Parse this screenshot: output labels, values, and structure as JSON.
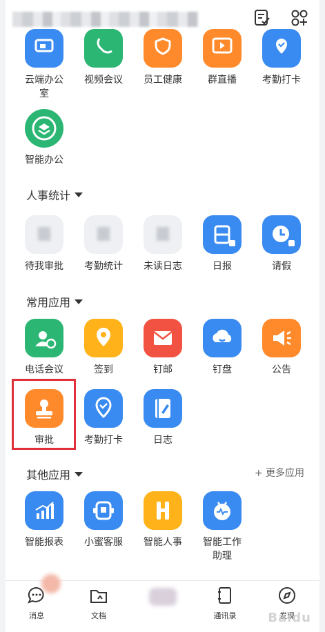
{
  "top_icons": [
    "todo-list-icon",
    "app-grid-icon"
  ],
  "row1": [
    {
      "label": "云端办公室",
      "icon": "cloud-office-icon",
      "color": "blue"
    },
    {
      "label": "视频会议",
      "icon": "video-call-icon",
      "color": "green"
    },
    {
      "label": "员工健康",
      "icon": "health-shield-icon",
      "color": "orange"
    },
    {
      "label": "群直播",
      "icon": "live-play-icon",
      "color": "orange"
    },
    {
      "label": "考勤打卡",
      "icon": "location-check-icon",
      "color": "blue"
    }
  ],
  "row2": [
    {
      "label": "智能办公",
      "icon": "layers-icon",
      "color": "green"
    }
  ],
  "hr_section": {
    "title": "人事统计",
    "items": [
      {
        "label": "待我审批",
        "icon": "blurred-icon"
      },
      {
        "label": "考勤统计",
        "icon": "blurred-icon"
      },
      {
        "label": "未读日志",
        "icon": "blurred-icon"
      },
      {
        "label": "日报",
        "icon": "daily-report-icon"
      },
      {
        "label": "请假",
        "icon": "clock-icon"
      }
    ]
  },
  "common_section": {
    "title": "常用应用",
    "items": [
      {
        "label": "电话会议",
        "icon": "phone-conference-icon",
        "color": "green"
      },
      {
        "label": "签到",
        "icon": "checkin-pin-icon",
        "color": "yellow"
      },
      {
        "label": "钉邮",
        "icon": "mail-icon",
        "color": "red"
      },
      {
        "label": "钉盘",
        "icon": "cloud-drive-icon",
        "color": "blue"
      },
      {
        "label": "公告",
        "icon": "megaphone-icon",
        "color": "orange"
      },
      {
        "label": "审批",
        "icon": "stamp-icon",
        "color": "orange"
      },
      {
        "label": "考勤打卡",
        "icon": "location-check-icon",
        "color": "blue"
      },
      {
        "label": "日志",
        "icon": "notebook-icon",
        "color": "blue"
      }
    ]
  },
  "other_section": {
    "title": "其他应用",
    "more_label": "+ 更多应用",
    "items": [
      {
        "label": "智能报表",
        "icon": "bar-chart-icon",
        "color": "blue"
      },
      {
        "label": "小蜜客服",
        "icon": "customer-service-icon",
        "color": "blue"
      },
      {
        "label": "智能人事",
        "icon": "h-letter-icon",
        "color": "yellow"
      },
      {
        "label": "智能工作助理",
        "label_line1": "智能工作",
        "label_line2": "助理",
        "icon": "robot-assistant-icon",
        "color": "blue"
      }
    ]
  },
  "tabbar": [
    {
      "label": "消息",
      "icon": "message-icon"
    },
    {
      "label": "文档",
      "icon": "document-folder-icon"
    },
    {
      "label": "",
      "icon": "blurred-icon"
    },
    {
      "label": "通讯录",
      "icon": "contacts-icon"
    },
    {
      "label": "发现",
      "icon": "compass-icon"
    }
  ],
  "colors": {
    "blue": "#3a8bf1",
    "green": "#2bb673",
    "orange": "#ff8a2b",
    "yellow": "#ffb21a",
    "red": "#f25241",
    "highlight": "#e0313b"
  }
}
